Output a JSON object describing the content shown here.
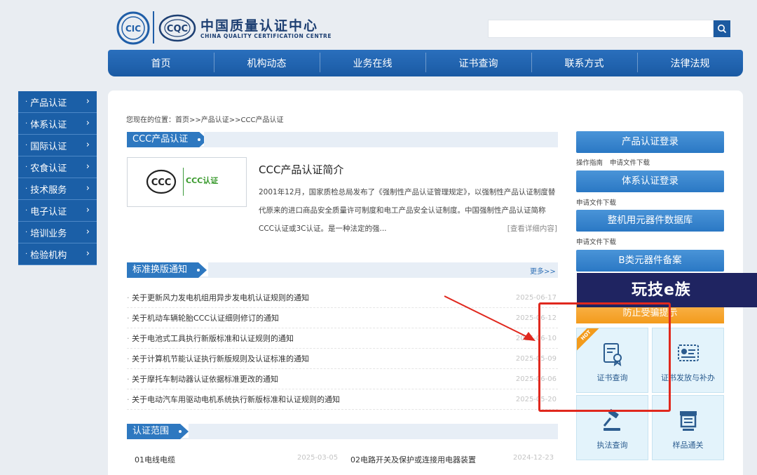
{
  "header": {
    "org_name_cn": "中国质量认证中心",
    "org_name_en": "CHINA QUALITY CERTIFICATION CENTRE",
    "logo_left": "CIC",
    "logo_right": "CQC",
    "search_placeholder": ""
  },
  "nav": {
    "items": [
      "首页",
      "机构动态",
      "业务在线",
      "证书查询",
      "联系方式",
      "法律法规"
    ]
  },
  "sidebar": {
    "items": [
      "产品认证",
      "体系认证",
      "国际认证",
      "农食认证",
      "技术服务",
      "电子认证",
      "培训业务",
      "检验机构"
    ]
  },
  "breadcrumb": "您现在的位置：首页>>产品认证>>CCC产品认证",
  "intro": {
    "section_title": "CCC产品认证",
    "logo_label": "CCC认证",
    "title": "CCC产品认证简介",
    "body": "2001年12月，国家质检总局发布了《强制性产品认证管理规定》，以强制性产品认证制度替代原来的进口商品安全质量许可制度和电工产品安全认证制度。中国强制性产品认证简称CCC认证或3C认证。是一种法定的强...",
    "detail_link": "[查看详细内容]"
  },
  "notices": {
    "section_title": "标准换版通知",
    "more": "更多>>",
    "items": [
      {
        "title": "关于更新风力发电机组用异步发电机认证规则的通知",
        "date": "2025-06-17"
      },
      {
        "title": "关于机动车辆轮胎CCC认证细则修订的通知",
        "date": "2025-06-12"
      },
      {
        "title": "关于电池式工具执行新版标准和认证规则的通知",
        "date": "2025-06-10"
      },
      {
        "title": "关于计算机节能认证执行新版规则及认证标准的通知",
        "date": "2025-05-09"
      },
      {
        "title": "关于摩托车制动器认证依据标准更改的通知",
        "date": "2025-06-06"
      },
      {
        "title": "关于电动汽车用驱动电机系统执行新版标准和认证规则的通知",
        "date": "2025-05-20"
      }
    ]
  },
  "scope": {
    "section_title": "认证范围",
    "items": [
      {
        "title": "01电线电缆",
        "date": "2025-03-05"
      },
      {
        "title": "02电路开关及保护或连接用电器装置",
        "date": "2024-12-23"
      }
    ]
  },
  "right": {
    "btn_product_login": "产品认证登录",
    "links_product": [
      "操作指南",
      "申请文件下载"
    ],
    "btn_system_login": "体系认证登录",
    "links_system": [
      "申请文件下载"
    ],
    "btn_component_db": "整机用元器件数据库",
    "links_component": [
      "申请文件下载"
    ],
    "btn_b_component": "B类元器件备案",
    "btn_anti_fraud": "防止受骗提示",
    "hot_badge": "HOT",
    "tiles": [
      "证书查询",
      "证书发放与补办",
      "执法查询",
      "样品通关"
    ]
  },
  "watermark": "玩技e族",
  "colors": {
    "nav_blue": "#1a5aa3",
    "accent_blue": "#2e78c0",
    "orange": "#f39b1c",
    "annotation_red": "#e0281e"
  }
}
